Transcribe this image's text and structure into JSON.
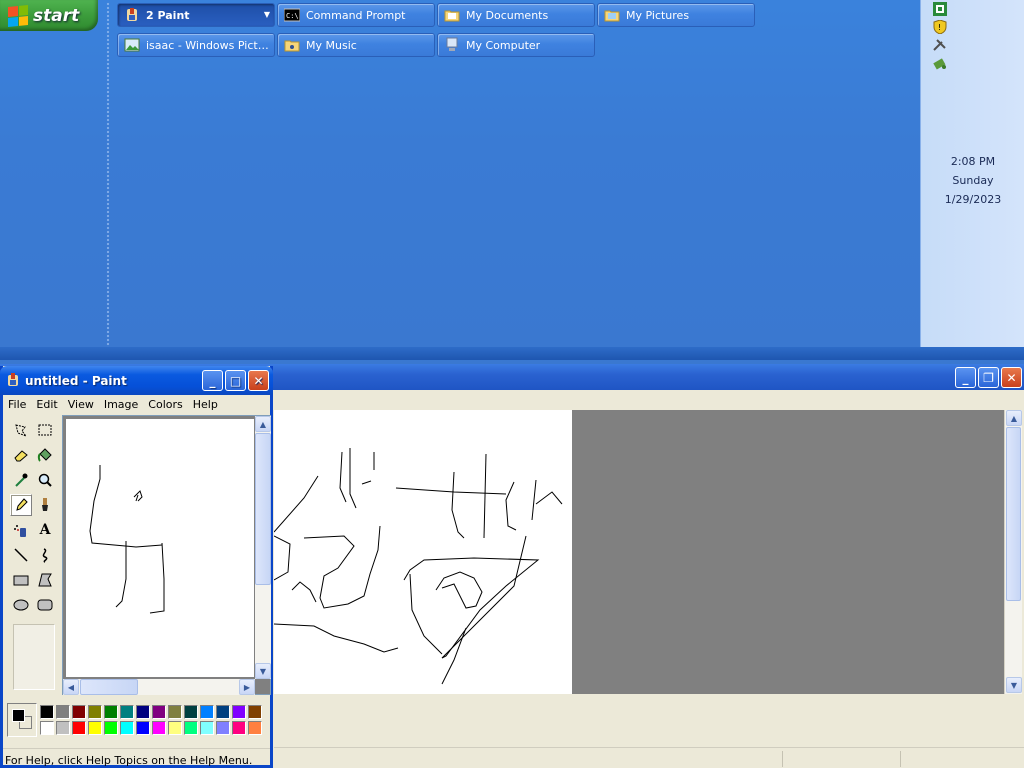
{
  "taskbar": {
    "start_label": "start",
    "buttons": [
      {
        "label": "2 Paint",
        "icon": "paint-group-icon",
        "active": true
      },
      {
        "label": "Command Prompt",
        "icon": "cmd-icon"
      },
      {
        "label": "My Documents",
        "icon": "folder-icon"
      },
      {
        "label": "My Pictures",
        "icon": "folder-icon"
      },
      {
        "label": "isaac - Windows Pictu...",
        "icon": "picture-viewer-icon"
      },
      {
        "label": "My Music",
        "icon": "folder-icon"
      },
      {
        "label": "My Computer",
        "icon": "computer-icon"
      }
    ]
  },
  "tray": {
    "icons": [
      "network-icon",
      "security-shield-icon",
      "tools-icon",
      "safely-remove-icon"
    ],
    "time": "2:08 PM",
    "day": "Sunday",
    "date": "1/29/2023"
  },
  "paint": {
    "title": "untitled - Paint",
    "menu": [
      "File",
      "Edit",
      "View",
      "Image",
      "Colors",
      "Help"
    ],
    "status": "For Help, click Help Topics on the Help Menu.",
    "tools": [
      "free-form-select-icon",
      "select-icon",
      "eraser-icon",
      "fill-icon",
      "pick-color-icon",
      "magnifier-icon",
      "pencil-icon",
      "brush-icon",
      "airbrush-icon",
      "text-icon",
      "line-icon",
      "curve-icon",
      "rectangle-icon",
      "polygon-icon",
      "ellipse-icon",
      "rounded-rectangle-icon"
    ],
    "selected_tool": "pencil-icon",
    "text_tool_label": "A",
    "palette_top": [
      "#000000",
      "#808080",
      "#800000",
      "#808000",
      "#008000",
      "#008080",
      "#000080",
      "#800080",
      "#808040",
      "#004040",
      "#0080ff",
      "#004080",
      "#8000ff",
      "#804000"
    ],
    "palette_bottom": [
      "#ffffff",
      "#c0c0c0",
      "#ff0000",
      "#ffff00",
      "#00ff00",
      "#00ffff",
      "#0000ff",
      "#ff00ff",
      "#ffff80",
      "#00ff80",
      "#80ffff",
      "#8080ff",
      "#ff0080",
      "#ff8040"
    ],
    "foreground": "#000000",
    "background": "#ffffff"
  },
  "colors": {
    "desktop": "#3a78d0",
    "title_bar": "#0650d8",
    "window_face": "#ece9d8"
  }
}
